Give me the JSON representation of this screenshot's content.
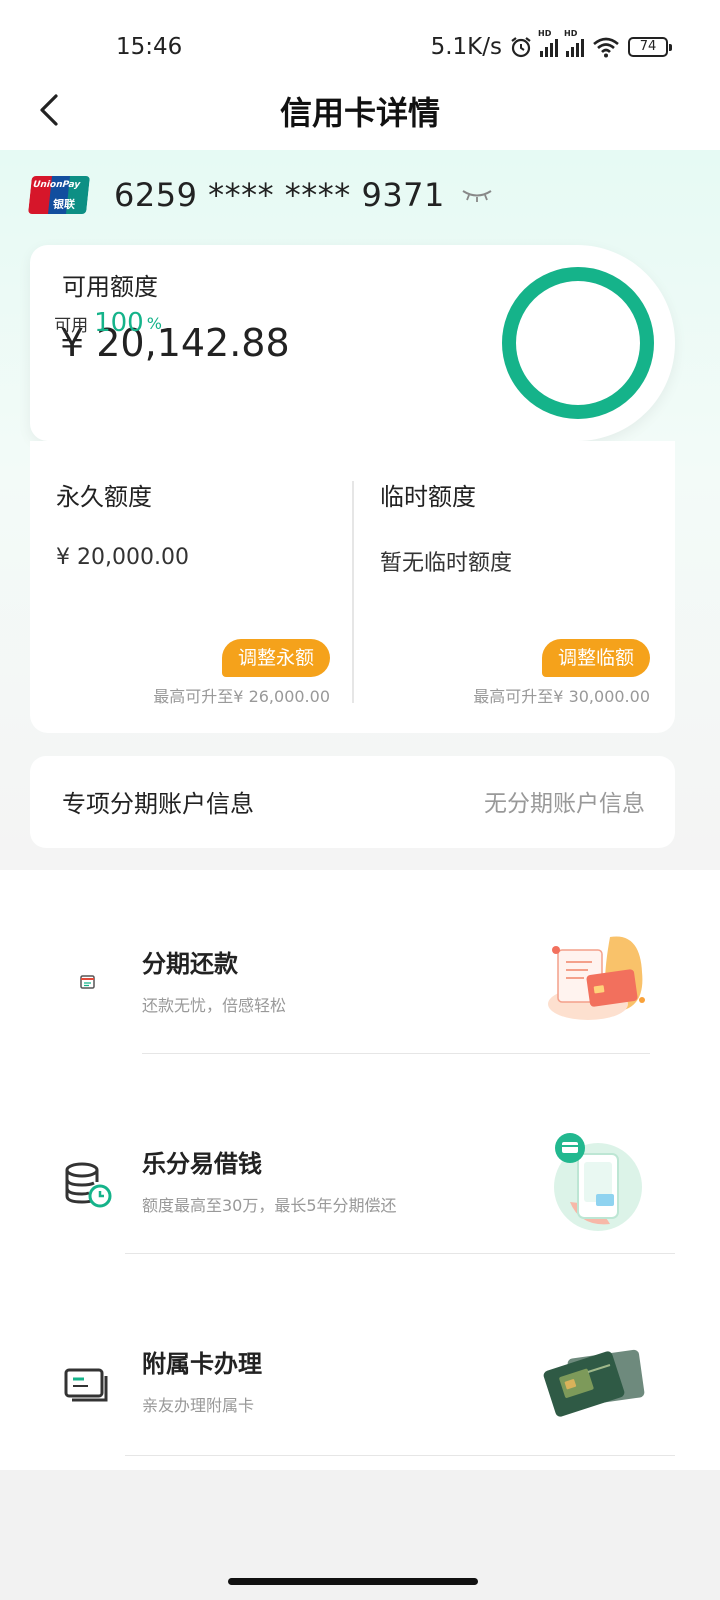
{
  "status_bar": {
    "time": "15:46",
    "net_speed": "5.1K/s",
    "battery": "74"
  },
  "nav": {
    "title": "信用卡详情"
  },
  "card": {
    "brand_en": "UnionPay",
    "brand_cn": "银联",
    "number": "6259 **** **** 9371"
  },
  "available": {
    "label": "可用额度",
    "amount": "¥ 20,142.88",
    "ring_label": "可用",
    "ring_percent": "100",
    "ring_unit": "%",
    "ring_fraction": 1.0
  },
  "limits": {
    "permanent": {
      "title": "永久额度",
      "value": "¥ 20,000.00",
      "button": "调整永额",
      "note": "最高可升至¥ 26,000.00"
    },
    "temporary": {
      "title": "临时额度",
      "value": "暂无临时额度",
      "button": "调整临额",
      "note": "最高可升至¥ 30,000.00"
    }
  },
  "installment_account": {
    "label": "专项分期账户信息",
    "value": "无分期账户信息"
  },
  "services": [
    {
      "title": "分期还款",
      "desc": "还款无忧，倍感轻松",
      "icon": "calendar-icon"
    },
    {
      "title": "乐分易借钱",
      "desc": "额度最高至30万，最长5年分期偿还",
      "icon": "coin-stack-clock-icon"
    },
    {
      "title": "附属卡办理",
      "desc": "亲友办理附属卡",
      "icon": "card-icon"
    }
  ],
  "colors": {
    "accent": "#15b38a",
    "button": "#f5a21b"
  }
}
